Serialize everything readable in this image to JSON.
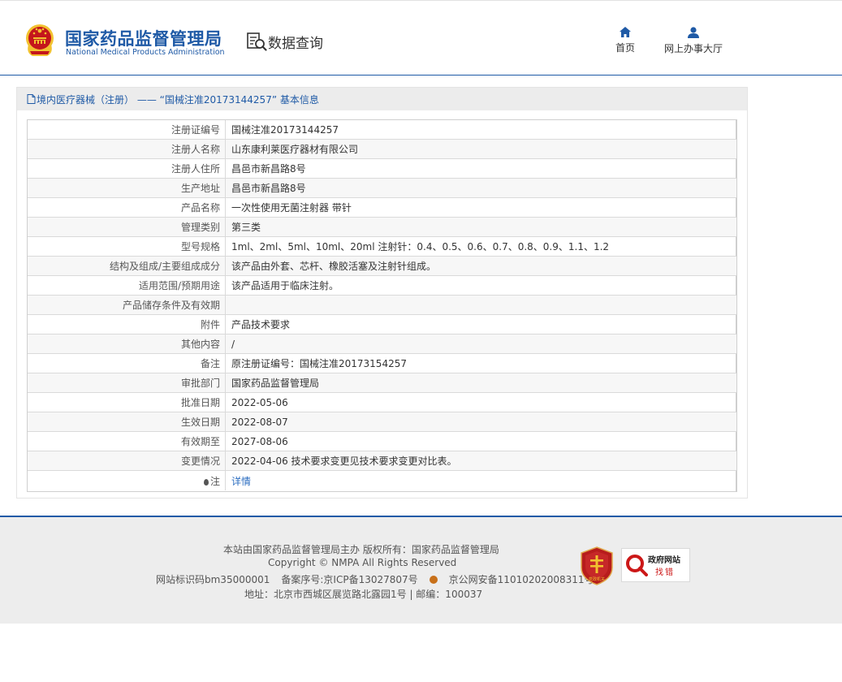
{
  "header": {
    "org_name_cn": "国家药品监督管理局",
    "org_name_en": "National Medical Products Administration",
    "data_query_label": "数据查询",
    "nav": [
      {
        "label": "首页",
        "icon": "home-icon"
      },
      {
        "label": "网上办事大厅",
        "icon": "user-icon"
      }
    ]
  },
  "panel": {
    "breadcrumb": "境内医疗器械（注册） —— “国械注准20173144257” 基本信息",
    "rows": [
      {
        "label": "注册证编号",
        "value": "国械注准20173144257"
      },
      {
        "label": "注册人名称",
        "value": "山东康利莱医疗器材有限公司"
      },
      {
        "label": "注册人住所",
        "value": "昌邑市新昌路8号"
      },
      {
        "label": "生产地址",
        "value": "昌邑市新昌路8号"
      },
      {
        "label": "产品名称",
        "value": "一次性使用无菌注射器 带针"
      },
      {
        "label": "管理类别",
        "value": "第三类"
      },
      {
        "label": "型号规格",
        "value": "1ml、2ml、5ml、10ml、20ml 注射针：0.4、0.5、0.6、0.7、0.8、0.9、1.1、1.2"
      },
      {
        "label": "结构及组成/主要组成成分",
        "value": "该产品由外套、芯杆、橡胶活塞及注射针组成。"
      },
      {
        "label": "适用范围/预期用途",
        "value": "该产品适用于临床注射。"
      },
      {
        "label": "产品储存条件及有效期",
        "value": ""
      },
      {
        "label": "附件",
        "value": "产品技术要求"
      },
      {
        "label": "其他内容",
        "value": "/"
      },
      {
        "label": "备注",
        "value": "原注册证编号：国械注准20173154257"
      },
      {
        "label": "审批部门",
        "value": "国家药品监督管理局"
      },
      {
        "label": "批准日期",
        "value": "2022-05-06"
      },
      {
        "label": "生效日期",
        "value": "2022-08-07"
      },
      {
        "label": "有效期至",
        "value": "2027-08-06"
      },
      {
        "label": "变更情况",
        "value": "2022-04-06 技术要求变更见技术要求变更对比表。"
      }
    ],
    "note_row": {
      "label": "注",
      "link_text": "详情"
    }
  },
  "footer": {
    "line1": "本站由国家药品监督管理局主办 版权所有：国家药品监督管理局",
    "line2": "Copyright © NMPA All Rights Reserved",
    "site_id": "网站标识码bm35000001",
    "icp": "备案序号:京ICP备13027807号",
    "police": "京公网安备11010202008311号",
    "address": "地址：北京市西城区展览路北露园1号 | 邮编：100037",
    "party_badge_label": "党政机关",
    "gov_badge_line1": "政府网站",
    "gov_badge_line2": "找错"
  },
  "colors": {
    "brand_blue": "#1f5aa6",
    "link_blue": "#2a6cc0",
    "panel_header_bg": "#ececec",
    "footer_bg": "#ededed",
    "emblem_red": "#c4161c",
    "emblem_gold": "#f2c230"
  }
}
